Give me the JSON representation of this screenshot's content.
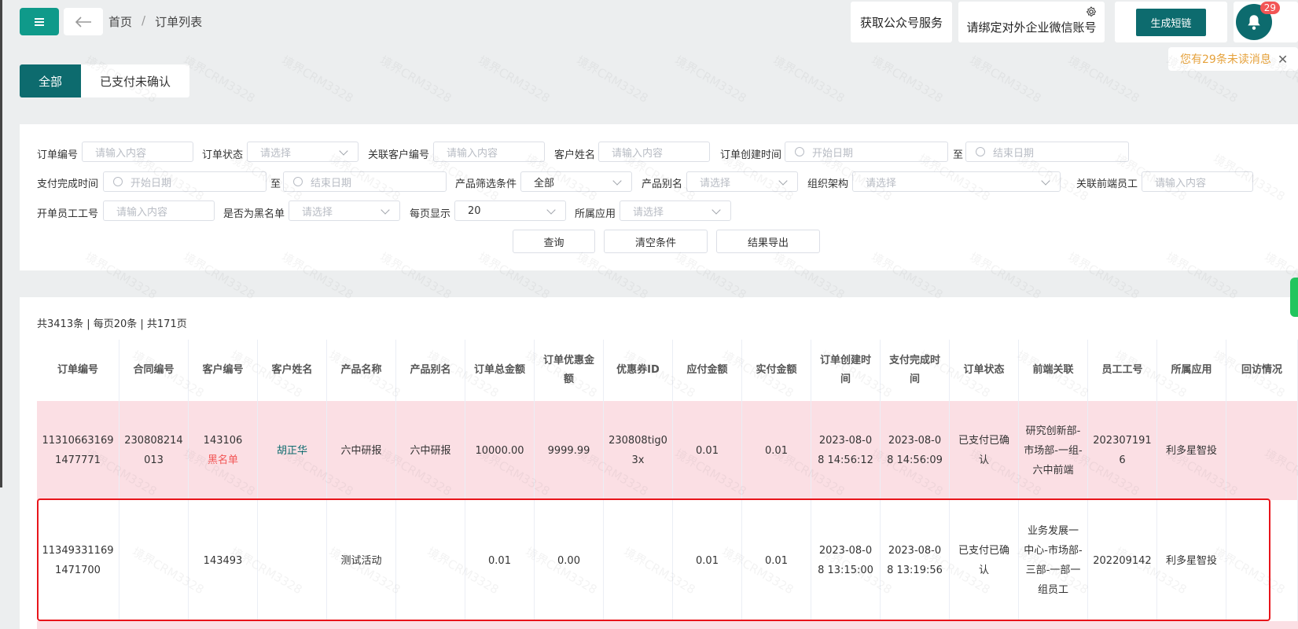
{
  "breadcrumb": {
    "home": "首页",
    "sep": "/",
    "current": "订单列表"
  },
  "top_actions": {
    "public_account": "获取公众号服务",
    "bind_wecom": "请绑定对外企业微信账号",
    "short_link": "生成短链",
    "unread_badge": "29",
    "unread_toast": "您有29条未读消息"
  },
  "tabs": [
    "全部",
    "已支付未确认"
  ],
  "filters": {
    "order_no": {
      "label": "订单编号",
      "placeholder": "请输入内容"
    },
    "order_status": {
      "label": "订单状态",
      "placeholder": "请选择"
    },
    "customer_no": {
      "label": "关联客户编号",
      "placeholder": "请输入内容"
    },
    "customer_name": {
      "label": "客户姓名",
      "placeholder": "请输入内容"
    },
    "create_time": {
      "label": "订单创建时间",
      "start": "开始日期",
      "to": "至",
      "end": "结束日期"
    },
    "pay_time": {
      "label": "支付完成时间",
      "start": "开始日期",
      "to": "至",
      "end": "结束日期"
    },
    "product_filter": {
      "label": "产品筛选条件",
      "value": "全部"
    },
    "product_alias": {
      "label": "产品别名",
      "placeholder": "请选择"
    },
    "org": {
      "label": "组织架构",
      "placeholder": "请选择"
    },
    "frontend_staff": {
      "label": "关联前端员工",
      "placeholder": "请输入内容"
    },
    "staff_no": {
      "label": "开单员工工号",
      "placeholder": "请输入内容"
    },
    "blacklist": {
      "label": "是否为黑名单",
      "placeholder": "请选择"
    },
    "page_size": {
      "label": "每页显示",
      "value": "20"
    },
    "app": {
      "label": "所属应用",
      "placeholder": "请选择"
    }
  },
  "buttons": {
    "query": "查询",
    "clear": "清空条件",
    "export": "结果导出"
  },
  "summary": "共3413条 | 每页20条 | 共171页",
  "table": {
    "columns": [
      "订单编号",
      "合同编号",
      "客户编号",
      "客户姓名",
      "产品名称",
      "产品别名",
      "订单总金额",
      "订单优惠金额",
      "优惠券ID",
      "应付金额",
      "实付金额",
      "订单创建时间",
      "支付完成时间",
      "订单状态",
      "前端关联",
      "员工工号",
      "所属应用",
      "回访情况"
    ],
    "rows": [
      {
        "order_no": "113106631691477771",
        "contract_no": "230808214013",
        "customer_no": "143106",
        "blacklist_tag": "黑名单",
        "customer_name": "胡正华",
        "product": "六中研报",
        "product_alias": "六中研报",
        "total": "10000.00",
        "discount": "9999.99",
        "coupon": "230808tig03x",
        "payable": "0.01",
        "paid": "0.01",
        "created": "2023-08-08 14:56:12",
        "completed": "2023-08-08 14:56:09",
        "status": "已支付已确认",
        "frontend": "研究创新部-市场部-一组-六中前端",
        "staff_no": "2023071916",
        "app": "利多星智投",
        "visit": ""
      },
      {
        "order_no": "113493311691471700",
        "contract_no": "",
        "customer_no": "143493",
        "blacklist_tag": "",
        "customer_name": "",
        "product": "测试活动",
        "product_alias": "",
        "total": "0.01",
        "discount": "0.00",
        "coupon": "",
        "payable": "0.01",
        "paid": "0.01",
        "created": "2023-08-08 13:15:00",
        "completed": "2023-08-08 13:19:56",
        "status": "已支付已确认",
        "frontend": "业务发展一中心-市场部-三部-一部一组员工",
        "staff_no": "202209142",
        "app": "利多星智投",
        "visit": ""
      }
    ]
  },
  "watermark": "境界CRM3328",
  "colors": {
    "primary": "#0d6b6e",
    "accent_green": "#0f9a8a",
    "row_blacklist_bg": "#fbdfe4",
    "highlight_border": "#e8151b",
    "danger": "#f25555",
    "warning": "#e6a23c"
  }
}
